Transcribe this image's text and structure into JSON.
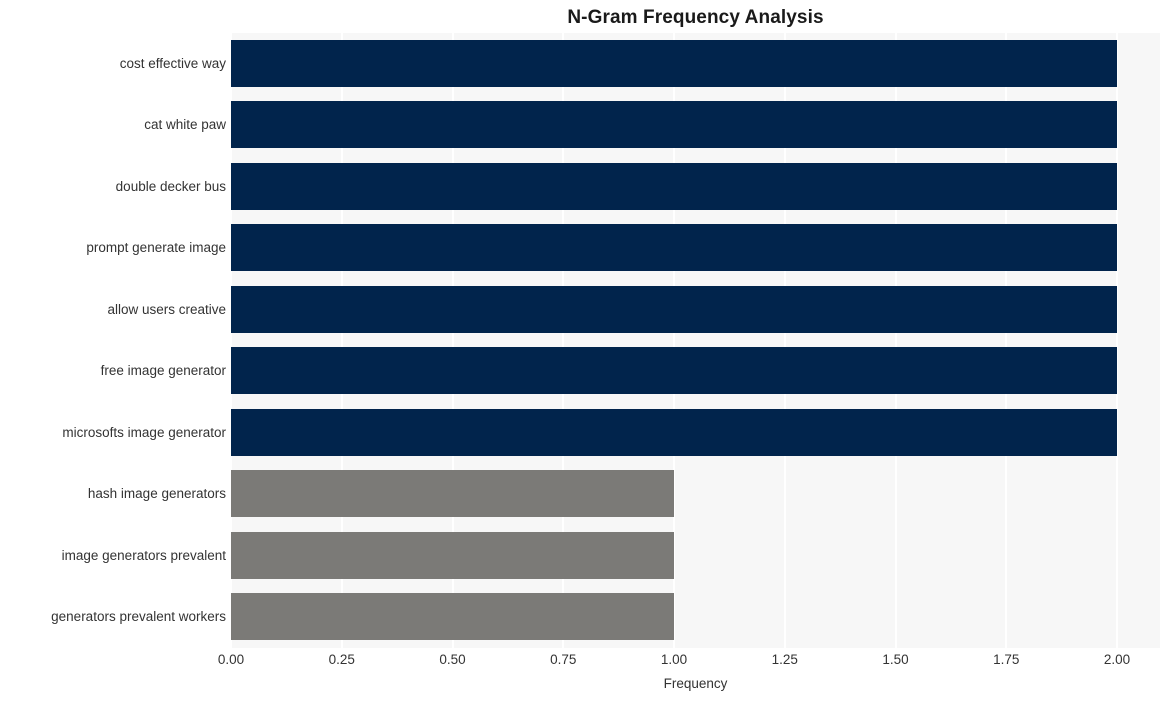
{
  "chart_data": {
    "type": "bar",
    "orientation": "horizontal",
    "title": "N-Gram Frequency Analysis",
    "xlabel": "Frequency",
    "ylabel": "",
    "xlim": [
      0.0,
      2.0
    ],
    "grid": true,
    "legend": null,
    "xticks": [
      "0.00",
      "0.25",
      "0.50",
      "0.75",
      "1.00",
      "1.25",
      "1.50",
      "1.75",
      "2.00"
    ],
    "xtick_values": [
      0.0,
      0.25,
      0.5,
      0.75,
      1.0,
      1.25,
      1.5,
      1.75,
      2.0
    ],
    "categories": [
      "cost effective way",
      "cat white paw",
      "double decker bus",
      "prompt generate image",
      "allow users creative",
      "free image generator",
      "microsofts image generator",
      "hash image generators",
      "image generators prevalent",
      "generators prevalent workers"
    ],
    "values": [
      2,
      2,
      2,
      2,
      2,
      2,
      2,
      1,
      1,
      1
    ],
    "bar_colors": [
      "#01244c",
      "#01244c",
      "#01244c",
      "#01244c",
      "#01244c",
      "#01244c",
      "#01244c",
      "#7b7a77",
      "#7b7a77",
      "#7b7a77"
    ]
  },
  "style": {
    "plot_background": "#f7f7f7",
    "figure_background": "#ffffff",
    "gridline_color": "#ffffff",
    "text_color": "#333333",
    "title_color": "#1a1a1a"
  }
}
